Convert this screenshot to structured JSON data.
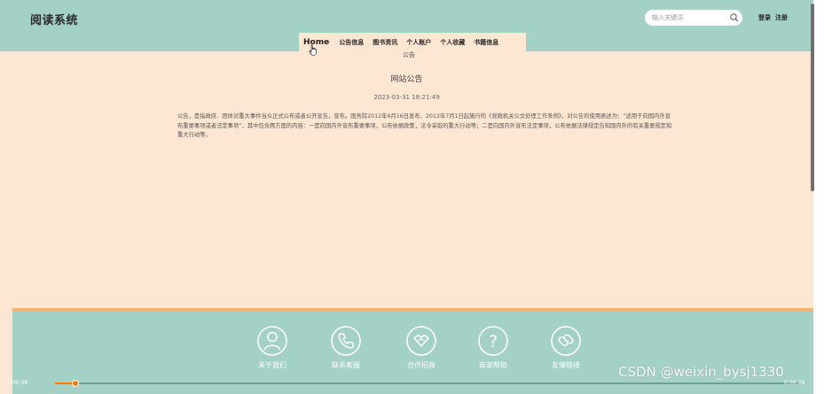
{
  "header": {
    "brand": "阅读系统",
    "search_placeholder": "输入关键词",
    "login": "登录",
    "register": "注册"
  },
  "nav": {
    "items": [
      "Home",
      "公告信息",
      "图书资讯",
      "个人账户",
      "个人收藏",
      "书籍信息"
    ],
    "active": "Home"
  },
  "breadcrumb": "公告",
  "article": {
    "title": "网站公告",
    "date": "2023-03-31 18:21:49",
    "body": "公告，是指政府、团体对重大事件当众正式公布或者公开宣告，宣布。国务院2012年4月16日发布、2012年7月1日起施行的《党政机关公文处理工作条例》，对公告的使用表述为：“适用于向国内外宣布重要事项或者法定事项”，其中包含两方面的内容：一是向国内外宣布重要事项，公布依据政策，法令采取的重大行动等；二是向国内外宣布法定事项，公布依据法律规定告知国内外的有关重要规定和重大行动等。"
  },
  "footer": {
    "items": [
      {
        "label": "关于我们",
        "icon": "person-icon"
      },
      {
        "label": "联系客服",
        "icon": "phone-icon"
      },
      {
        "label": "合作招商",
        "icon": "handshake-icon"
      },
      {
        "label": "商家帮助",
        "icon": "question-icon"
      },
      {
        "label": "友情链接",
        "icon": "link-icon"
      }
    ]
  },
  "video": {
    "current_time": "0:00:08",
    "total_time": "0:06:29",
    "progress": 0.027
  },
  "watermark": "CSDN @weixin_bysj1330",
  "colors": {
    "header_bg": "#a3d1c5",
    "page_bg": "#fde6d2",
    "accent_line": "#f3b274",
    "progress": "#ff7a00"
  }
}
